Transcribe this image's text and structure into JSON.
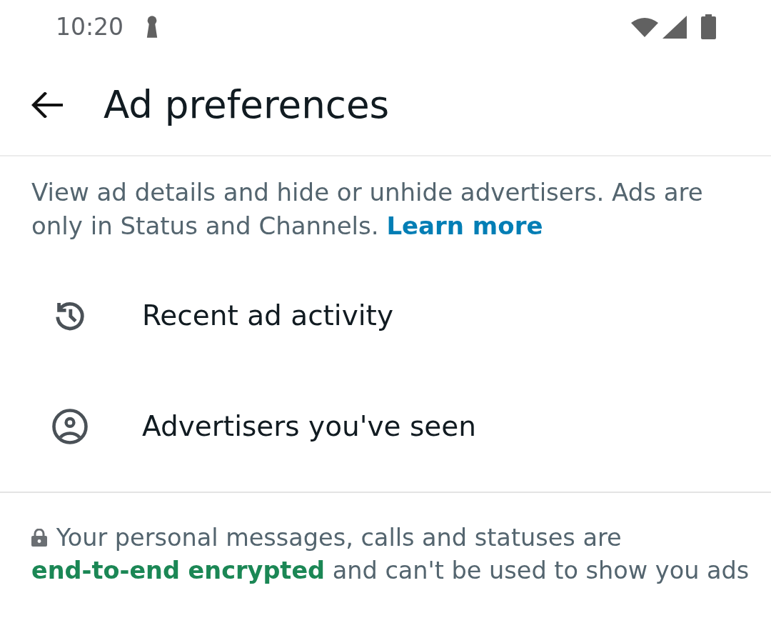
{
  "status_bar": {
    "time": "10:20"
  },
  "app_bar": {
    "title": "Ad preferences"
  },
  "description": {
    "text": "View ad details and hide or unhide advertisers. Ads are only in Status and Channels.",
    "link": "Learn more"
  },
  "items": [
    {
      "kind": "history",
      "label": "Recent ad activity"
    },
    {
      "kind": "person",
      "label": "Advertisers you've seen"
    }
  ],
  "footer": {
    "text_before": "Your personal messages, calls and statuses are",
    "link": "end-to-end encrypted",
    "text_after": "and can't be used to show you ads"
  }
}
